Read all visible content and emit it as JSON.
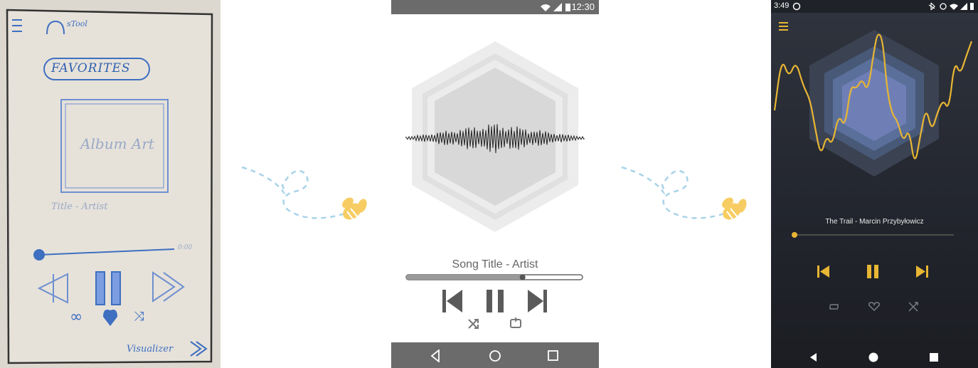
{
  "sketch": {
    "app_name": "sTool",
    "tab_label": "FAVORITES",
    "album_art_label": "Album Art",
    "title_artist_label": "Title - Artist",
    "time_label": "0:00",
    "brand_label": "Visualizer"
  },
  "wireframe": {
    "status_time": "12:30",
    "song_title": "Song Title - Artist",
    "progress": 0.66
  },
  "dark": {
    "status_time": "3:49",
    "track_title": "The Trail - Marcin Przybyłowicz",
    "progress": 0.0,
    "accent_color": "#e8b634",
    "background_color": "#25282f"
  },
  "decor": {
    "bee_color": "#f7cd63",
    "trail_color": "#a8d3e8"
  }
}
